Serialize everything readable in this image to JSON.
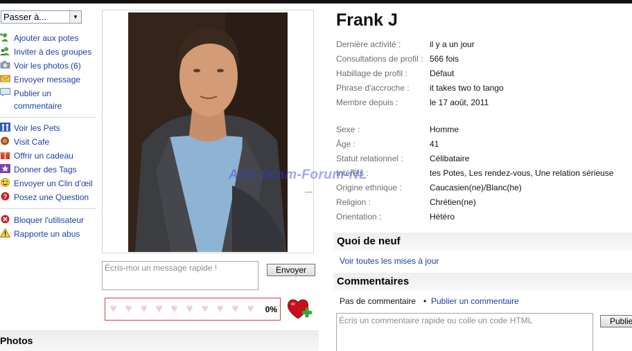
{
  "nav": {
    "jump_label": "Passer à..."
  },
  "actions": [
    {
      "label": "Ajouter aux potes",
      "icon": "add-friend-icon"
    },
    {
      "label": "Inviter à des groupes",
      "icon": "invite-group-icon"
    },
    {
      "label": "Voir les photos (6)",
      "icon": "camera-icon"
    },
    {
      "label": "Envoyer message",
      "icon": "envelope-icon"
    },
    {
      "label": "Publier un",
      "label2": "commentaire",
      "icon": "comment-icon"
    },
    {
      "label": "Voir les Pets",
      "icon": "pets-icon"
    },
    {
      "label": "Visit Cafe",
      "icon": "cafe-icon"
    },
    {
      "label": "Offrir un cadeau",
      "icon": "gift-icon"
    },
    {
      "label": "Donner des Tags",
      "icon": "star-icon"
    },
    {
      "label": "Envoyer un Clin d'œil",
      "icon": "wink-icon"
    },
    {
      "label": "Posez une Question",
      "icon": "question-icon"
    },
    {
      "label": "Bloquer l'utilisateur",
      "icon": "block-icon"
    },
    {
      "label": "Rapporte un abus",
      "icon": "warning-icon"
    }
  ],
  "quick_message": {
    "placeholder": "Écris-moi un message rapide !",
    "send_label": "Envoyer"
  },
  "rating": {
    "hearts_total": 10,
    "percent": "0%"
  },
  "photos_section": {
    "title": "Photos"
  },
  "profile": {
    "name": "Frank J",
    "fields": [
      {
        "key": "Dernière activité :",
        "value": "il y a un jour"
      },
      {
        "key": "Consultations de profil :",
        "value": "566 fois"
      },
      {
        "key": "Habillage de profil :",
        "value": "Défaut"
      },
      {
        "key": "Phrase d'accroche :",
        "value": "it takes two to tango"
      },
      {
        "key": "Membre depuis :",
        "value": "le 17 août, 2011"
      },
      {
        "key": "Sexe :",
        "value": "Homme"
      },
      {
        "key": "Âge :",
        "value": "41"
      },
      {
        "key": "Statut relationnel :",
        "value": "Célibataire"
      },
      {
        "key": "Intérêts :",
        "value": "Potes, Les rendez-vous, Une relation sérieuse",
        "value_prefix": "tes "
      },
      {
        "key": "Origine ethnique :",
        "value": "Caucasien(ne)/Blanc(he)"
      },
      {
        "key": "Religion :",
        "value": "Chrétien(ne)"
      },
      {
        "key": "Orientation :",
        "value": "Hétéro"
      }
    ]
  },
  "watermark": "Anti-Scam-Forum-NL",
  "news": {
    "title": "Quoi de neuf",
    "link": "Voir toutes les mises à jour"
  },
  "comments": {
    "title": "Commentaires",
    "none_text": "Pas de commentaire",
    "bullet": "•",
    "publish_link": "Publier un commentaire",
    "placeholder": "Écris un commentaire rapide ou colle un code HTML",
    "publish_button": "Publier"
  },
  "colors": {
    "link": "#1a3fa8",
    "rating_border": "#c8434d",
    "watermark": "#2e3cf0"
  }
}
